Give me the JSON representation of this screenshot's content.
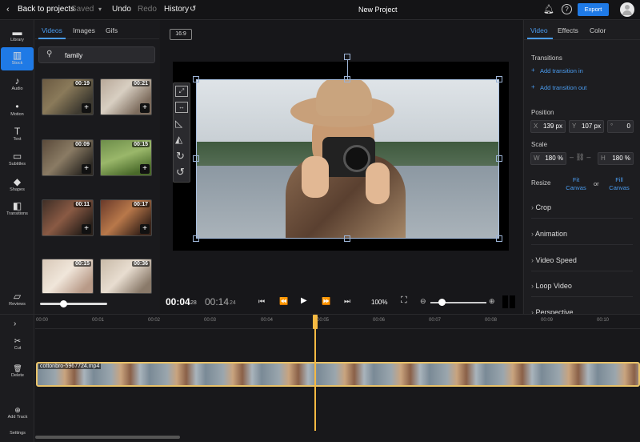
{
  "topbar": {
    "back_label": "Back to projects",
    "saved_label": "Saved",
    "undo_label": "Undo",
    "redo_label": "Redo",
    "history_label": "History",
    "project_title": "New Project",
    "export_label": "Export"
  },
  "rail": {
    "items": [
      {
        "label": "Library",
        "icon": "folder-icon"
      },
      {
        "label": "Stock",
        "icon": "stock-icon"
      },
      {
        "label": "Audio",
        "icon": "music-icon"
      },
      {
        "label": "Motion",
        "icon": "motion-icon"
      },
      {
        "label": "Text",
        "icon": "text-icon"
      },
      {
        "label": "Subtitles",
        "icon": "subtitles-icon"
      },
      {
        "label": "Shapes",
        "icon": "shapes-icon"
      },
      {
        "label": "Transitions",
        "icon": "transitions-icon"
      },
      {
        "label": "Reviews",
        "icon": "chat-icon"
      }
    ]
  },
  "media": {
    "tabs": [
      "Videos",
      "Images",
      "Gifs"
    ],
    "search_value": "family",
    "durations": [
      "00:19",
      "00:21",
      "00:09",
      "00:15",
      "00:11",
      "00:17",
      "00:15",
      "00:36"
    ]
  },
  "canvas": {
    "aspect_label": "16:9",
    "current_time": "00:04",
    "current_frame": "28",
    "total_time": "00:14",
    "total_frame": "24",
    "zoom": "100%"
  },
  "right": {
    "tabs": [
      "Video",
      "Effects",
      "Color"
    ],
    "transitions_label": "Transitions",
    "add_in": "Add transition in",
    "add_out": "Add transition out",
    "position_label": "Position",
    "pos_x_label": "X",
    "pos_x": "139 px",
    "pos_y_label": "Y",
    "pos_y": "107 px",
    "rotation": "0",
    "scale_label": "Scale",
    "scale_w_label": "W",
    "scale_w": "180 %",
    "scale_h_label": "H",
    "scale_h": "180 %",
    "resize_label": "Resize",
    "fit_canvas": "Fit Canvas",
    "or_label": "or",
    "fill_canvas": "Fill Canvas",
    "sections": [
      "Crop",
      "Animation",
      "Video Speed",
      "Loop Video",
      "Perspective"
    ]
  },
  "timeline": {
    "ticks": [
      "00:00",
      "00:01",
      "00:02",
      "00:03",
      "00:04",
      "00:05",
      "00:06",
      "00:07",
      "00:08",
      "00:09",
      "00:10"
    ],
    "clip_name": "cottonbro-5967724.mp4",
    "rail": [
      "Cut",
      "Delete",
      "Add Track",
      "Settings"
    ]
  }
}
